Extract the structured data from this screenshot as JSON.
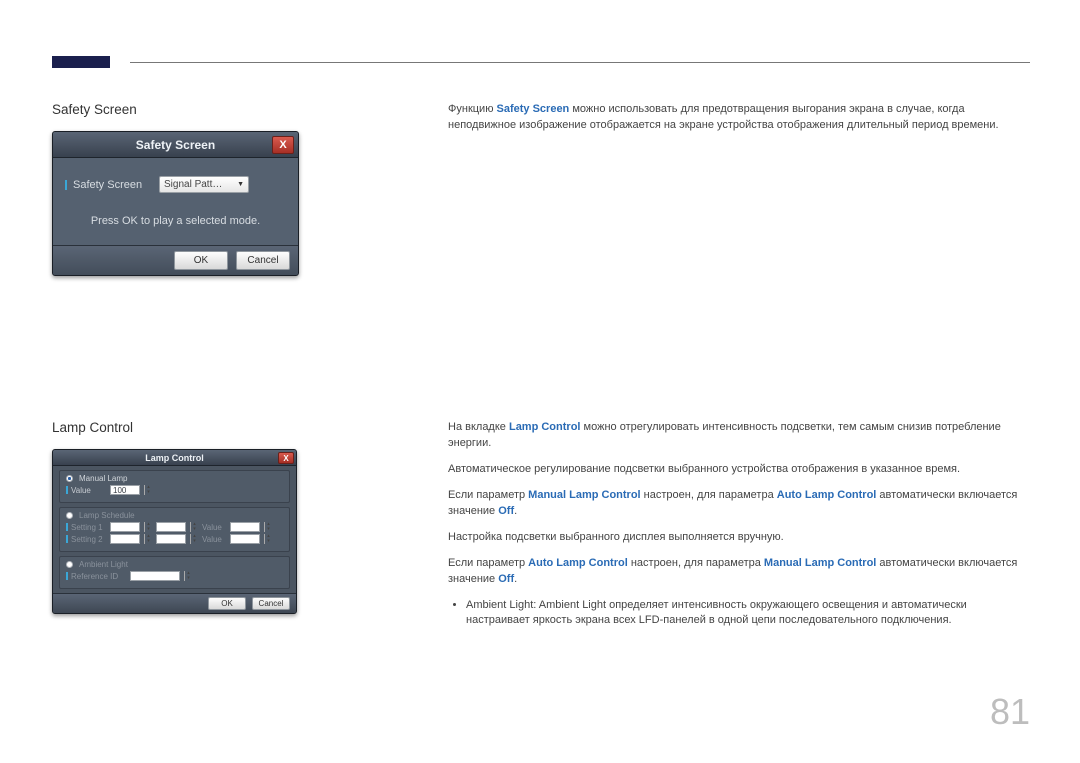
{
  "page_number": "81",
  "section1": {
    "heading": "Safety Screen",
    "dialog": {
      "title": "Safety Screen",
      "close": "X",
      "field_label": "Safety Screen",
      "dropdown_value": "Signal Patt…",
      "message": "Press OK to play a selected mode.",
      "ok": "OK",
      "cancel": "Cancel"
    },
    "body": {
      "p1_pre": "Функцию ",
      "p1_hl": "Safety Screen",
      "p1_post": " можно использовать для предотвращения выгорания экрана в случае, когда неподвижное изображение отображается на экране устройства отображения длительный период времени."
    }
  },
  "section2": {
    "heading": "Lamp Control",
    "dialog": {
      "title": "Lamp Control",
      "close": "X",
      "group_manual": "Manual Lamp",
      "value_label": "Value",
      "value_val": "100",
      "group_schedule": "Lamp Schedule",
      "setting1": "Setting 1",
      "setting2": "Setting 2",
      "schedule_value_label": "Value",
      "group_ambient": "Ambient Light",
      "reference_label": "Reference ID",
      "ok": "OK",
      "cancel": "Cancel"
    },
    "body": {
      "p1_pre": "На вкладке ",
      "p1_hl": "Lamp Control",
      "p1_post": " можно отрегулировать интенсивность подсветки, тем самым снизив потребление энергии.",
      "p2": "Автоматическое регулирование подсветки выбранного устройства отображения в указанное время.",
      "p3_pre": "Если параметр ",
      "p3_hl1": "Manual Lamp Control",
      "p3_mid": " настроен, для параметра ",
      "p3_hl2": "Auto Lamp Control",
      "p3_post": " автоматически включается значение ",
      "p3_off": "Off",
      "p3_dot": ".",
      "p4": "Настройка подсветки выбранного дисплея выполняется вручную.",
      "p5_pre": "Если параметр ",
      "p5_hl1": "Auto Lamp Control",
      "p5_mid": " настроен, для параметра ",
      "p5_hl2": "Manual Lamp Control",
      "p5_post": " автоматически включается значение ",
      "p5_off": "Off",
      "p5_dot": ".",
      "bullet_hl1": "Ambient Light",
      "bullet_sep": ": ",
      "bullet_hl2": "Ambient Light",
      "bullet_post": " определяет интенсивность окружающего освещения и автоматически настраивает яркость экрана всех LFD-панелей в одной цепи последовательного подключения."
    }
  }
}
